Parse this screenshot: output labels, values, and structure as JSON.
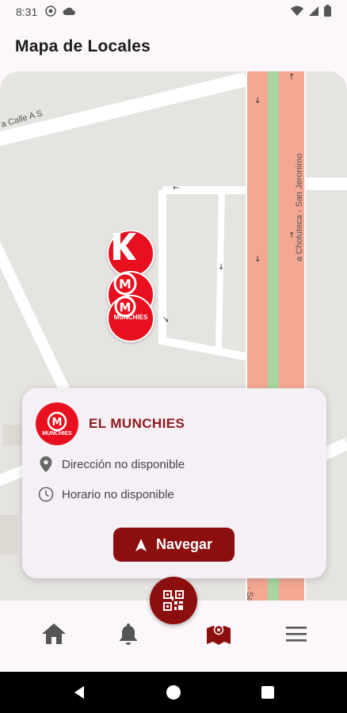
{
  "status_bar": {
    "time": "8:31"
  },
  "header": {
    "title": "Mapa de Locales"
  },
  "map": {
    "streets": {
      "calle_a": "a Calle A S",
      "choluteca": "a Choluteca - San Jeronimo",
      "sa": "- Sa"
    },
    "markers": [
      {
        "brand": "K",
        "color": "#e8101f"
      },
      {
        "brand": "M",
        "text": "MUNCHIES",
        "color": "#e8101f"
      },
      {
        "brand": "M",
        "text": "MUNCHIES",
        "color": "#e8101f"
      }
    ]
  },
  "card": {
    "name": "EL MUNCHIES",
    "logo_text": "MUNCHIES",
    "address": "Dirección no disponible",
    "hours": "Horario no disponible",
    "navigate_label": "Navegar"
  },
  "bottom_nav": {
    "items": [
      {
        "icon": "home-icon"
      },
      {
        "icon": "bell-icon"
      },
      {
        "icon": "map-icon",
        "active": true
      },
      {
        "icon": "menu-icon"
      }
    ],
    "fab_icon": "qr-code-icon"
  },
  "colors": {
    "brand": "#8c0f0f",
    "marker": "#e8101f",
    "highway": "#f4a792",
    "median": "#a8d5a2"
  }
}
